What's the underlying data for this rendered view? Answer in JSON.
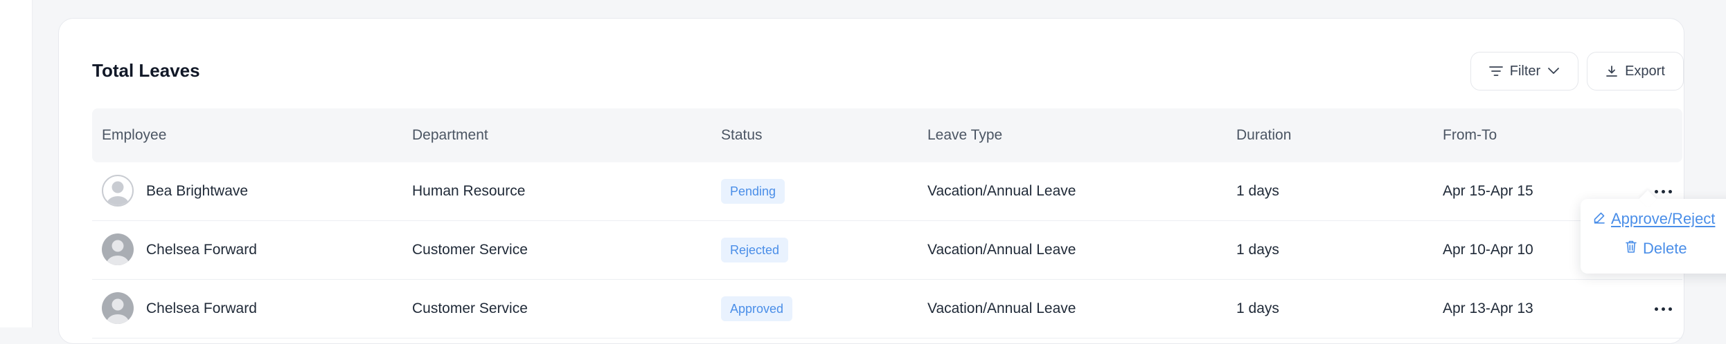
{
  "card": {
    "title": "Total Leaves",
    "filter_label": "Filter",
    "export_label": "Export"
  },
  "table": {
    "headers": [
      "Employee",
      "Department",
      "Status",
      "Leave Type",
      "Duration",
      "From-To"
    ],
    "rows": [
      {
        "employee": "Bea Brightwave",
        "avatar_style": "outline",
        "department": "Human Resource",
        "status": "Pending",
        "leave_type": "Vacation/Annual Leave",
        "duration": "1 days",
        "range": "Apr 15-Apr 15"
      },
      {
        "employee": "Chelsea Forward",
        "avatar_style": "filled",
        "department": "Customer Service",
        "status": "Rejected",
        "leave_type": "Vacation/Annual Leave",
        "duration": "1 days",
        "range": "Apr 10-Apr 10"
      },
      {
        "employee": "Chelsea Forward",
        "avatar_style": "filled",
        "department": "Customer Service",
        "status": "Approved",
        "leave_type": "Vacation/Annual Leave",
        "duration": "1 days",
        "range": "Apr 13-Apr 13"
      }
    ]
  },
  "action_menu": {
    "approve_reject_label": "Approve/Reject",
    "delete_label": "Delete",
    "approve_icon": "pencil-icon",
    "delete_icon": "trash-icon"
  },
  "icons": {
    "filter": "filter-lines-icon",
    "chevron": "chevron-down-icon",
    "export": "download-icon",
    "row_actions": "more-horizontal-icon"
  },
  "colors": {
    "accent": "#4a8ee8",
    "badge_bg": "#e9f2fe",
    "header_bg": "#f5f6f8"
  }
}
